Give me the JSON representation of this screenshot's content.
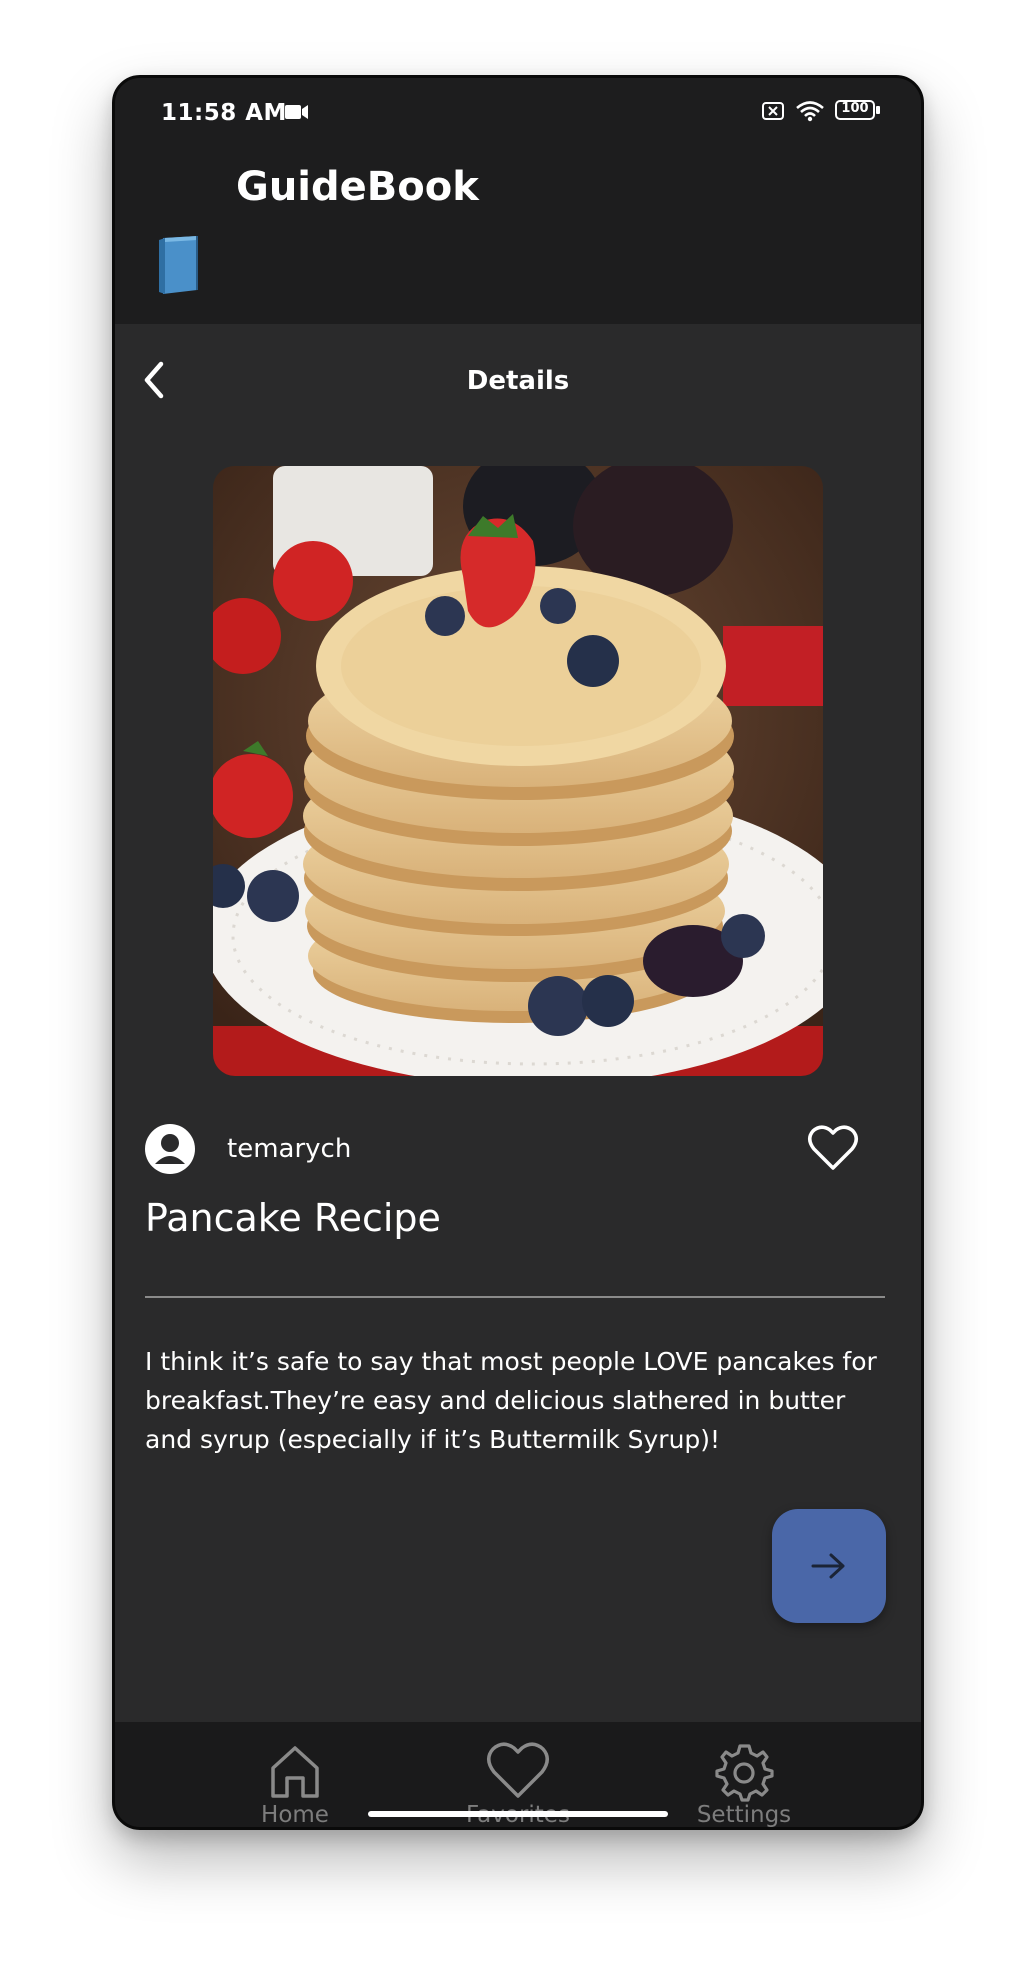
{
  "status_bar": {
    "time": "11:58 AM",
    "battery": "100"
  },
  "app_bar": {
    "title": "GuideBook",
    "logo_icon": "book-icon"
  },
  "header": {
    "title": "Details",
    "back_icon": "chevron-left-icon"
  },
  "post": {
    "image_alt": "stack of pancakes with berries",
    "author": "temarych",
    "title": "Pancake Recipe",
    "description": "I think it’s safe to say that most people LOVE pancakes for breakfast.They’re easy and delicious slathered in butter and syrup (especially if it’s Buttermilk Syrup)!",
    "favorite_icon": "heart-outline-icon"
  },
  "fab": {
    "icon": "arrow-right-icon",
    "color": "#4a67a8"
  },
  "bottom_nav": {
    "items": [
      {
        "label": "Home",
        "icon": "home-icon"
      },
      {
        "label": "Favorites",
        "icon": "heart-icon"
      },
      {
        "label": "Settings",
        "icon": "gear-icon"
      }
    ]
  },
  "colors": {
    "background": "#2a2a2b",
    "bar": "#1d1d1e",
    "nav": "#1a1a1b",
    "accent": "#4a67a8"
  }
}
